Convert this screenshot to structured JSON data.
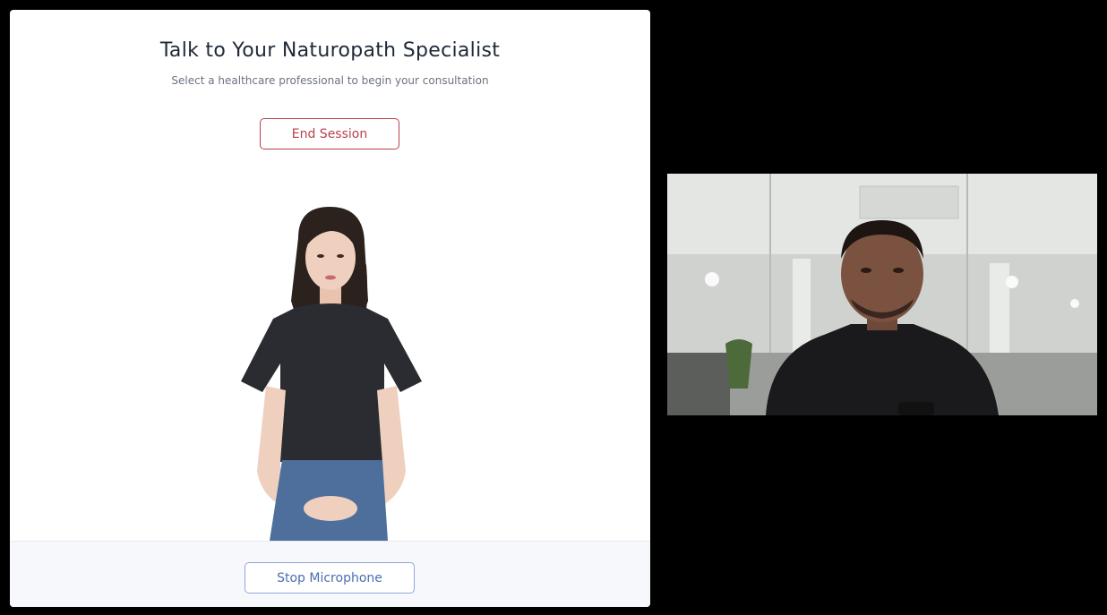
{
  "consultation": {
    "title": "Talk to Your Naturopath Specialist",
    "subtitle": "Select a healthcare professional to begin your consultation",
    "end_session_label": "End Session",
    "stop_microphone_label": "Stop Microphone"
  },
  "avatar": {
    "shirt_color": "#2a2c31",
    "jeans_color": "#4e6f9c",
    "hair_color": "#2b211d",
    "skin_color": "#efd0bf"
  },
  "webcam": {
    "shirt_color": "#1a1a1c",
    "skin_color": "#7b5240"
  },
  "colors": {
    "danger_accent": "#b8404f",
    "primary_accent": "#4a6fb0"
  }
}
